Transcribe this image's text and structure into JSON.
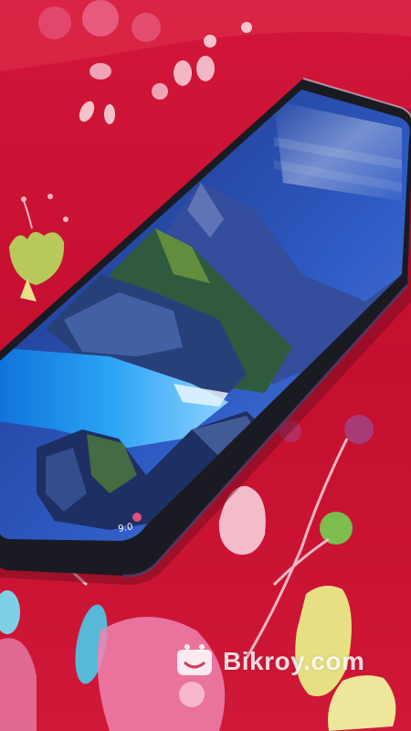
{
  "watermark": {
    "text": "Bikroy.com"
  },
  "phone": {
    "status_text": "9:0"
  },
  "colors": {
    "fabric": "#c8102e",
    "phone_frame": "#1a1a22",
    "sky": "#2a4fb8",
    "water": "#1f8de8",
    "rock": "#28407a"
  },
  "icons": [
    "bikroy-logo-icon"
  ]
}
